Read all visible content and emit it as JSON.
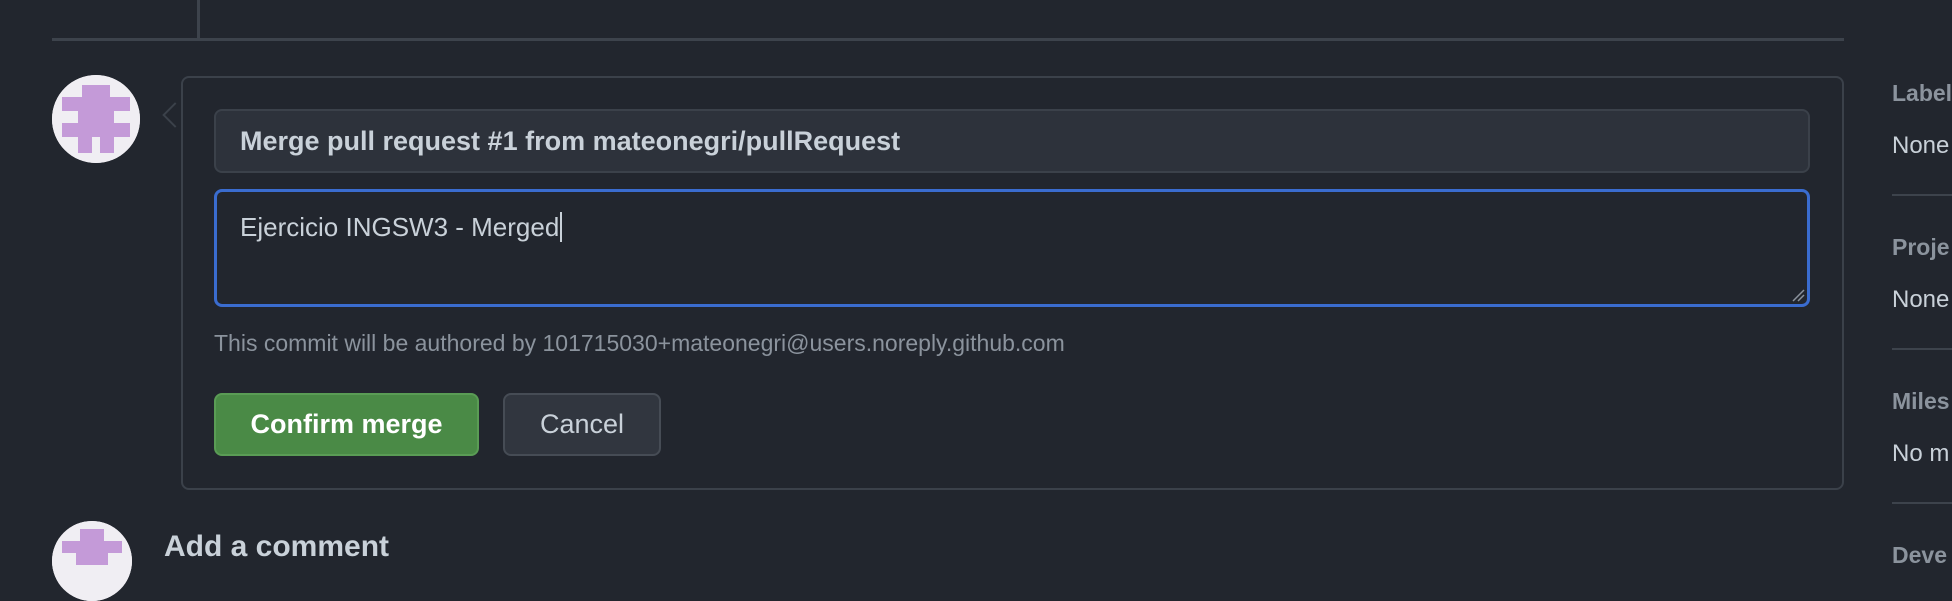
{
  "merge": {
    "title_value": "Merge pull request #1 from mateonegri/pullRequest",
    "body_value": "Ejercicio INGSW3 - Merged",
    "author_note": "This commit will be authored by 101715030+mateonegri@users.noreply.github.com",
    "confirm_label": "Confirm merge",
    "cancel_label": "Cancel"
  },
  "comment": {
    "heading": "Add a comment"
  },
  "sidebar": {
    "sections": [
      {
        "heading": "Label",
        "value": "None"
      },
      {
        "heading": "Proje",
        "value": "None"
      },
      {
        "heading": "Miles",
        "value": "No m"
      },
      {
        "heading": "Deve",
        "value": ""
      }
    ]
  },
  "colors": {
    "background": "#22262e",
    "confirm_green": "#4a8a46",
    "focus_blue": "#3a6ccf",
    "avatar_purple": "#c49ad8"
  },
  "icons": {
    "avatar": "identicon-avatar-icon",
    "resize": "resize-handle-icon"
  }
}
